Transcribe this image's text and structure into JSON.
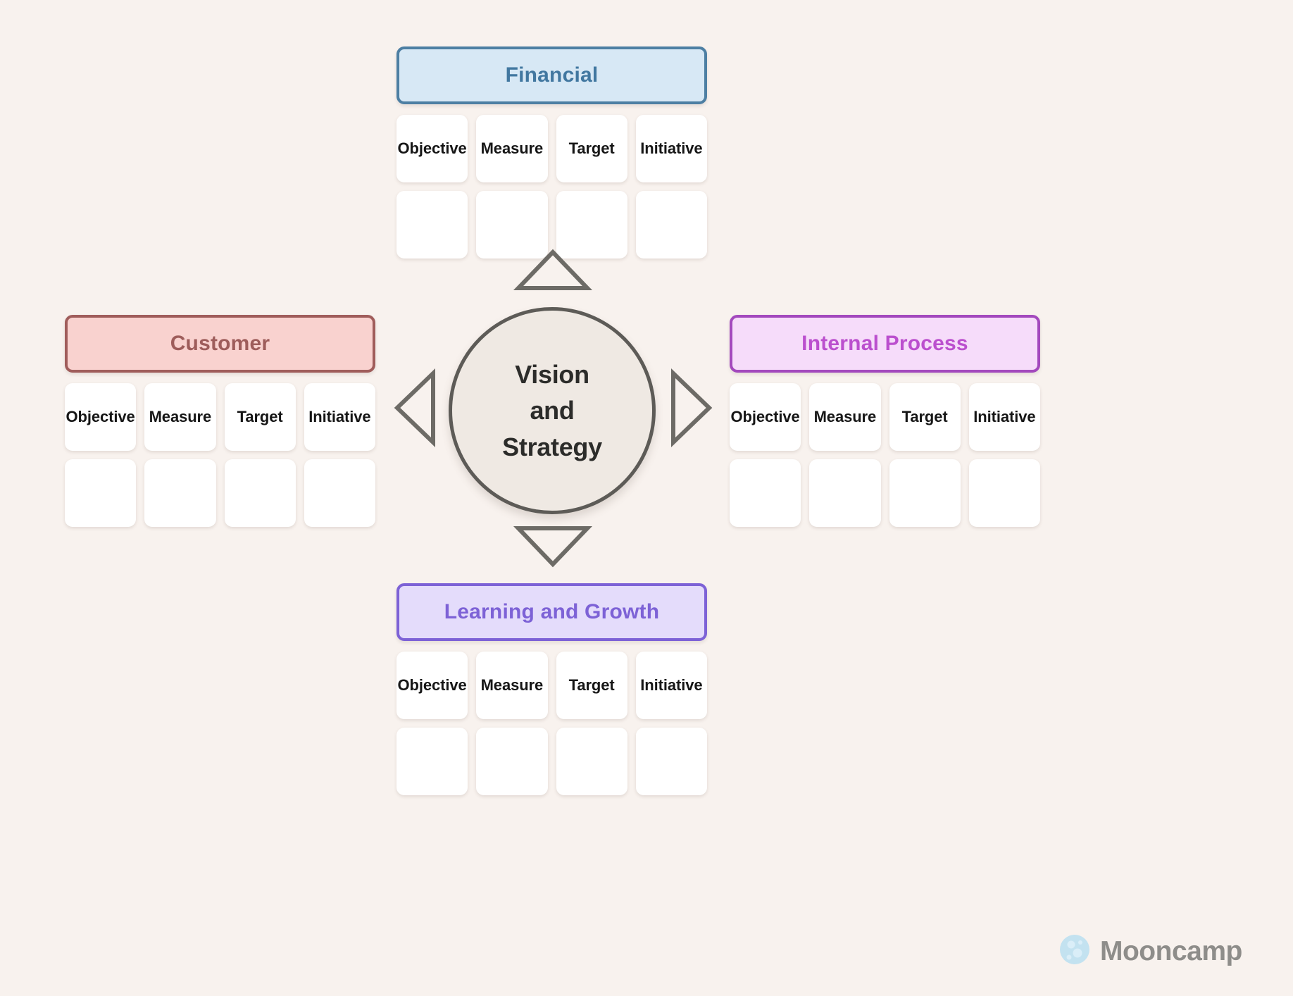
{
  "background_color": "#f8f2ee",
  "center": {
    "label": "Vision and Strategy",
    "line1": "Vision",
    "line2": "and",
    "line3": "Strategy",
    "fill_color": "#efe9e3",
    "stroke_color": "#5d5b57"
  },
  "column_headers": [
    "Objective",
    "Measure",
    "Target",
    "Initiative"
  ],
  "perspectives": [
    {
      "id": "financial",
      "title": "Financial",
      "position": "top",
      "fill_color": "#d7e8f5",
      "border_color": "#4d7fa3",
      "text_color": "#4177a0",
      "columns": [
        "Objective",
        "Measure",
        "Target",
        "Initiative"
      ],
      "values": [
        "",
        "",
        "",
        ""
      ]
    },
    {
      "id": "customer",
      "title": "Customer",
      "position": "left",
      "fill_color": "#f9d2cf",
      "border_color": "#a05d5b",
      "text_color": "#9e5d5b",
      "columns": [
        "Objective",
        "Measure",
        "Target",
        "Initiative"
      ],
      "values": [
        "",
        "",
        "",
        ""
      ]
    },
    {
      "id": "internal",
      "title": "Internal Process",
      "position": "right",
      "fill_color": "#f6dcfa",
      "border_color": "#a349bd",
      "text_color": "#bb4fce",
      "columns": [
        "Objective",
        "Measure",
        "Target",
        "Initiative"
      ],
      "values": [
        "",
        "",
        "",
        ""
      ]
    },
    {
      "id": "learning",
      "title": "Learning and Growth",
      "position": "bottom",
      "fill_color": "#e4dcfb",
      "border_color": "#7d62d6",
      "text_color": "#7d62d6",
      "columns": [
        "Objective",
        "Measure",
        "Target",
        "Initiative"
      ],
      "values": [
        "",
        "",
        "",
        ""
      ]
    }
  ],
  "arrows": [
    {
      "name": "arrow-up-icon",
      "direction": "up"
    },
    {
      "name": "arrow-right-icon",
      "direction": "right"
    },
    {
      "name": "arrow-down-icon",
      "direction": "down"
    },
    {
      "name": "arrow-left-icon",
      "direction": "left"
    }
  ],
  "logo": {
    "text": "Mooncamp",
    "icon": "moon-icon",
    "text_color": "#8e8d8a",
    "icon_color": "#bfe0ef"
  }
}
